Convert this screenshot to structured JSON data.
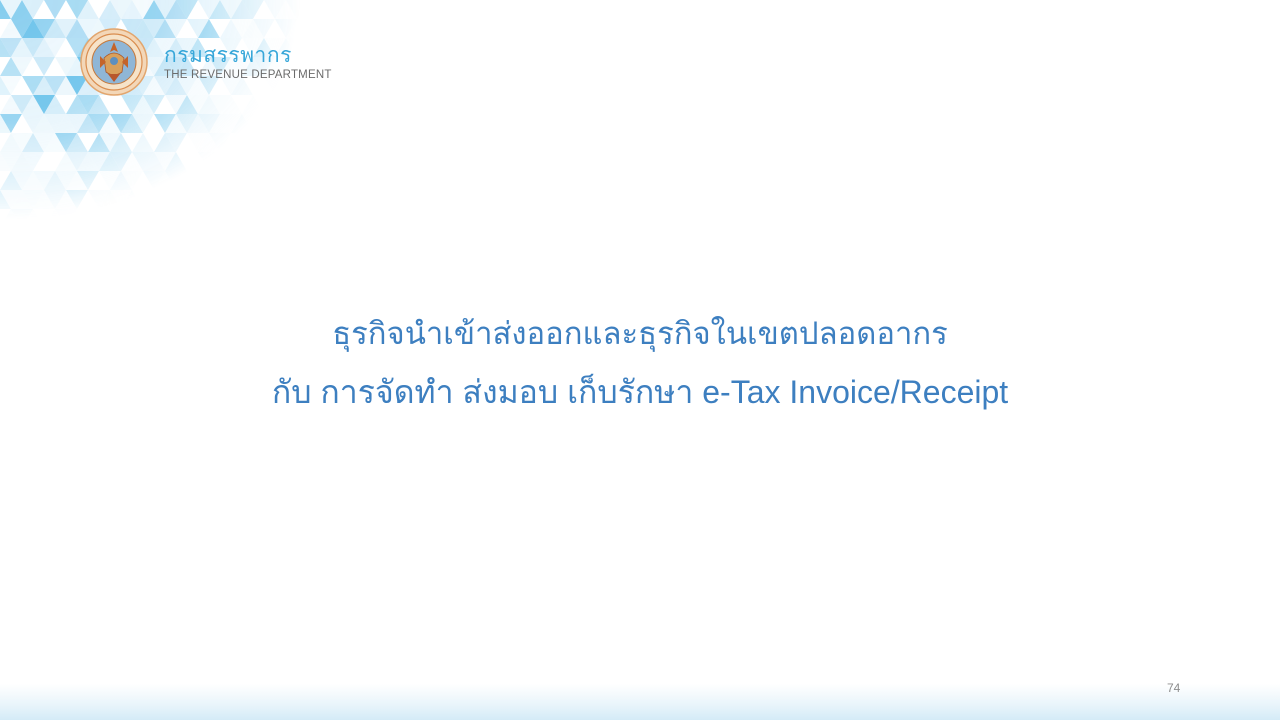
{
  "header": {
    "logo_thai": "กรมสรรพากร",
    "logo_english": "THE REVENUE DEPARTMENT",
    "seal_icon": "revenue-department-seal-icon"
  },
  "main": {
    "title_line_1": "ธุรกิจนำเข้าส่งออกและธุรกิจในเขตปลอดอากร",
    "title_line_2": "กับ การจัดทำ ส่งมอบ เก็บรักษา e-Tax Invoice/Receipt"
  },
  "footer": {
    "page_number": "74"
  },
  "colors": {
    "title": "#3d7fc0",
    "logo_thai": "#38a7d9",
    "logo_english": "#6b6b6b",
    "pattern_light": "#d6eefa",
    "pattern_mid": "#9fd6f2",
    "pattern_dark": "#5ebde9"
  }
}
